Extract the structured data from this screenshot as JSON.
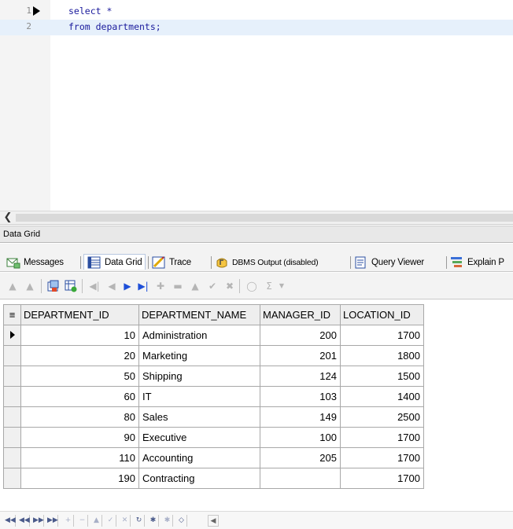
{
  "editor": {
    "lines": [
      {
        "num": "1",
        "code": "select *"
      },
      {
        "num": "2",
        "code": "from departments;"
      }
    ]
  },
  "pane": {
    "title": "Data Grid"
  },
  "tabs": [
    {
      "label": "Messages",
      "icon": "messages-icon"
    },
    {
      "label": "Data Grid",
      "icon": "data-grid-icon",
      "active": true
    },
    {
      "label": "Trace",
      "icon": "trace-icon"
    },
    {
      "label": "DBMS Output (disabled)",
      "icon": "dbms-output-icon"
    },
    {
      "label": "Query Viewer",
      "icon": "query-viewer-icon"
    },
    {
      "label": "Explain P",
      "icon": "explain-plan-icon"
    }
  ],
  "grid": {
    "columns": [
      "DEPARTMENT_ID",
      "DEPARTMENT_NAME",
      "MANAGER_ID",
      "LOCATION_ID"
    ],
    "rows": [
      [
        "10",
        "Administration",
        "200",
        "1700"
      ],
      [
        "20",
        "Marketing",
        "201",
        "1800"
      ],
      [
        "50",
        "Shipping",
        "124",
        "1500"
      ],
      [
        "60",
        "IT",
        "103",
        "1400"
      ],
      [
        "80",
        "Sales",
        "149",
        "2500"
      ],
      [
        "90",
        "Executive",
        "100",
        "1700"
      ],
      [
        "110",
        "Accounting",
        "205",
        "1700"
      ],
      [
        "190",
        "Contracting",
        "",
        "1700"
      ]
    ]
  },
  "colors": {
    "active_line": "#e6f0fb",
    "keyword": "#0000c8",
    "nav_blue": "#1e4fd8"
  }
}
